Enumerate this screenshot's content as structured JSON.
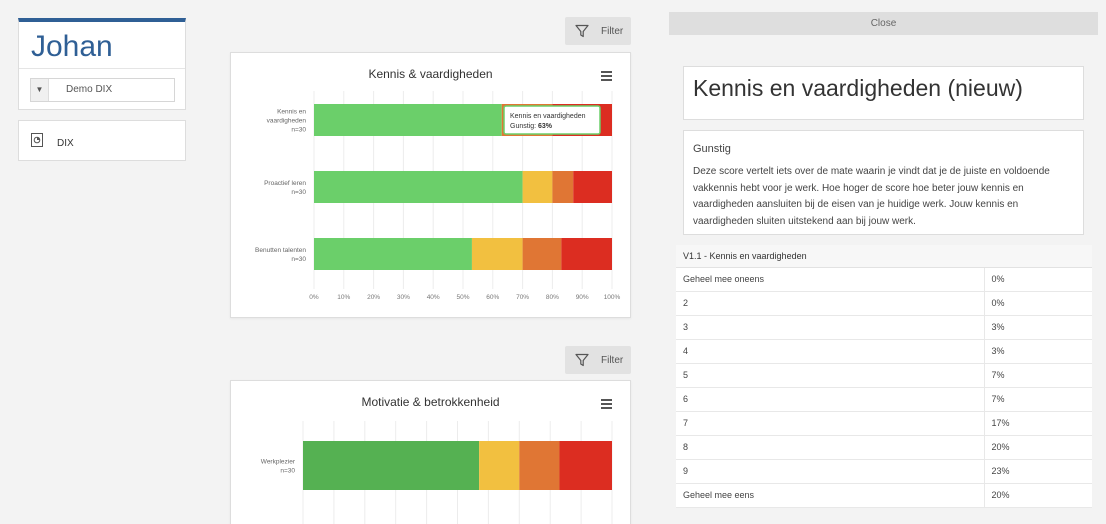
{
  "user": {
    "name": "Johan",
    "org_select": "Demo DIX"
  },
  "nav": {
    "item_label": "DIX"
  },
  "filter_label": "Filter",
  "charts": [
    {
      "title": "Kennis & vaardigheden",
      "tooltip": {
        "title": "Kennis en vaardigheden",
        "label": "Gunstig:",
        "value": "63%"
      }
    },
    {
      "title": "Motivatie & betrokkenheid"
    }
  ],
  "chart_data": [
    {
      "type": "bar",
      "stacked": true,
      "orientation": "horizontal",
      "title": "Kennis & vaardigheden",
      "categories": [
        [
          "Kennis en",
          "vaardigheden",
          "n=30"
        ],
        [
          "Proactief leren",
          "n=30"
        ],
        [
          "Benutten talenten",
          "n=30"
        ]
      ],
      "series": [
        {
          "color": "#6bcf6a",
          "values": [
            63,
            70,
            53
          ]
        },
        {
          "color": "#f2c040",
          "values": [
            0,
            10,
            17
          ]
        },
        {
          "color": "#e07634",
          "values": [
            17,
            7,
            13
          ]
        },
        {
          "color": "#dc2d21",
          "values": [
            20,
            13,
            17
          ]
        }
      ],
      "xlim": [
        0,
        100
      ],
      "x_ticks": [
        "0%",
        "10%",
        "20%",
        "30%",
        "40%",
        "50%",
        "60%",
        "70%",
        "80%",
        "90%",
        "100%"
      ],
      "grid": true
    },
    {
      "type": "bar",
      "stacked": true,
      "orientation": "horizontal",
      "title": "Motivatie & betrokkenheid",
      "categories": [
        [
          "Werkplezier",
          "n=30"
        ]
      ],
      "series": [
        {
          "color": "#55b152",
          "values": [
            57
          ]
        },
        {
          "color": "#f2c040",
          "values": [
            13
          ]
        },
        {
          "color": "#e07634",
          "values": [
            13
          ]
        },
        {
          "color": "#dc2d21",
          "values": [
            17
          ]
        }
      ],
      "xlim": [
        0,
        100
      ],
      "grid": true
    }
  ],
  "close_label": "Close",
  "detail": {
    "title": "Kennis en vaardigheden (nieuw)",
    "heading": "Gunstig",
    "description": "Deze score vertelt iets over de mate waarin je vindt dat je de juiste en voldoende vakkennis hebt voor je werk. Hoe hoger de score hoe beter jouw kennis en vaardigheden aansluiten bij de eisen van je huidige werk. Jouw kennis en vaardigheden sluiten uitstekend aan bij jouw werk.",
    "table_header": "V1.1 - Kennis en vaardigheden",
    "rows": [
      {
        "label": "Geheel mee oneens",
        "value": "0%"
      },
      {
        "label": "2",
        "value": "0%"
      },
      {
        "label": "3",
        "value": "3%"
      },
      {
        "label": "4",
        "value": "3%"
      },
      {
        "label": "5",
        "value": "7%"
      },
      {
        "label": "6",
        "value": "7%"
      },
      {
        "label": "7",
        "value": "17%"
      },
      {
        "label": "8",
        "value": "20%"
      },
      {
        "label": "9",
        "value": "23%"
      },
      {
        "label": "Geheel mee eens",
        "value": "20%"
      }
    ]
  }
}
